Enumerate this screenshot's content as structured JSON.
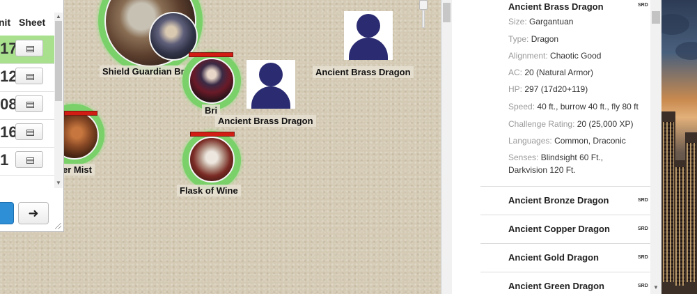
{
  "tracker": {
    "col_init": "nit",
    "col_sheet": "Sheet",
    "rows": [
      {
        "init": ".17",
        "active": true
      },
      {
        "init": ".12",
        "active": false
      },
      {
        "init": ".08",
        "active": false
      },
      {
        "init": ".16",
        "active": false
      },
      {
        "init": ".1",
        "active": false
      }
    ],
    "next_label": "➜"
  },
  "tokens": [
    {
      "label": "Shield Guardian Bri"
    },
    {
      "label": "Bri"
    },
    {
      "label": "Ancient Brass Dragon"
    },
    {
      "label": "Ancient Brass Dragon"
    },
    {
      "label": "er Mist"
    },
    {
      "label": "Flask of Wine"
    }
  ],
  "compendium": {
    "title": "Ancient Brass Dragon",
    "badge": "SRD",
    "attributes": [
      {
        "key": "Size:",
        "value": "Gargantuan"
      },
      {
        "key": "Type:",
        "value": "Dragon"
      },
      {
        "key": "Alignment:",
        "value": "Chaotic Good"
      },
      {
        "key": "AC:",
        "value": "20 (Natural Armor)"
      },
      {
        "key": "HP:",
        "value": "297 (17d20+119)"
      },
      {
        "key": "Speed:",
        "value": "40 ft., burrow 40 ft., fly 80 ft"
      },
      {
        "key": "Challenge Rating:",
        "value": "20 (25,000 XP)"
      },
      {
        "key": "Languages:",
        "value": "Common, Draconic"
      },
      {
        "key": "Senses:",
        "value": "Blindsight 60 Ft.,"
      }
    ],
    "senses_line2": "Darkvision 120 Ft.",
    "list": [
      {
        "title": "Ancient Bronze Dragon",
        "badge": "SRD"
      },
      {
        "title": "Ancient Copper Dragon",
        "badge": "SRD"
      },
      {
        "title": "Ancient Gold Dragon",
        "badge": "SRD"
      },
      {
        "title": "Ancient Green Dragon",
        "badge": "SRD"
      }
    ]
  },
  "colors": {
    "hp_bar": "#d11d14",
    "token_ring": "#7ad16a",
    "silhouette": "#2b2b72",
    "active_row": "#a8e08e",
    "button_blue": "#2f8fd6"
  }
}
